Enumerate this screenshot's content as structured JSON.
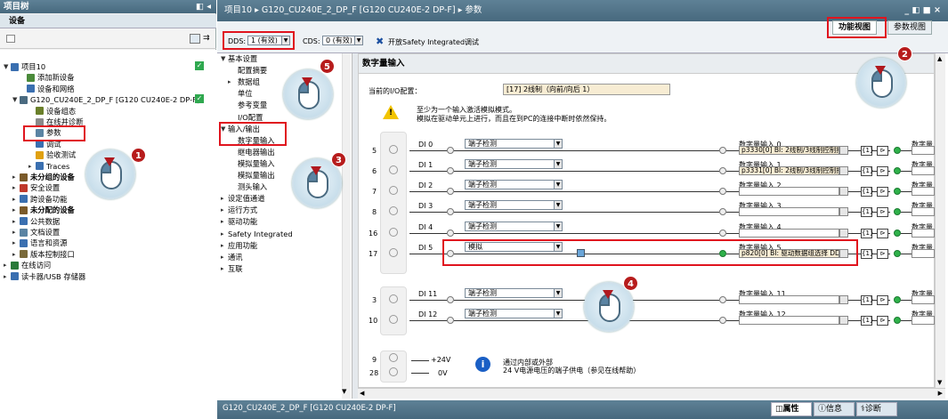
{
  "left": {
    "title": "项目树",
    "devices_tab": "设备",
    "tree": [
      {
        "label": "项目10",
        "bold": false,
        "check": true
      },
      {
        "label": "添加新设备"
      },
      {
        "label": "设备和网络"
      },
      {
        "label": "G120_CU240E_2_DP_F [G120 CU240E-2 DP-F]",
        "check": true
      },
      {
        "label": "设备组态"
      },
      {
        "label": "在线并诊断"
      },
      {
        "label": "参数"
      },
      {
        "label": "调试"
      },
      {
        "label": "验收测试"
      },
      {
        "label": "Traces"
      },
      {
        "label": "未分组的设备",
        "bold": true
      },
      {
        "label": "安全设置"
      },
      {
        "label": "跨设备功能"
      },
      {
        "label": "未分配的设备",
        "bold": true
      },
      {
        "label": "公共数据"
      },
      {
        "label": "文档设置"
      },
      {
        "label": "语言和资源"
      },
      {
        "label": "版本控制接口"
      },
      {
        "label": "在线访问"
      },
      {
        "label": "读卡器/USB 存储器"
      }
    ]
  },
  "breadcrumb": "项目10 ▸ G120_CU240E_2_DP_F [G120 CU240E-2 DP-F] ▸ 参数",
  "window_controls": "_ ◧ ■ ×",
  "toolbar": {
    "dds_label": "DDS:",
    "dds_value": "1 (有效)",
    "cds_label": "CDS:",
    "cds_value": "0 (有效)",
    "safety_btn": "开放Safety Integrated调试"
  },
  "tabs": {
    "function_view": "功能视图",
    "param_view": "参数视图"
  },
  "nav": [
    {
      "label": "基本设置",
      "level": 0,
      "open": true
    },
    {
      "label": "配置摘要",
      "level": 1
    },
    {
      "label": "数据组",
      "level": 1,
      "arrow": true
    },
    {
      "label": "单位",
      "level": 1
    },
    {
      "label": "参考变量",
      "level": 1
    },
    {
      "label": "I/O配置",
      "level": 1
    },
    {
      "label": "输入/输出",
      "level": 0,
      "open": true
    },
    {
      "label": "数字量输入",
      "level": 1
    },
    {
      "label": "继电器输出",
      "level": 1
    },
    {
      "label": "模拟量输入",
      "level": 1
    },
    {
      "label": "模拟量输出",
      "level": 1
    },
    {
      "label": "测头输入",
      "level": 1
    },
    {
      "label": "设定值通道",
      "level": 0
    },
    {
      "label": "运行方式",
      "level": 0
    },
    {
      "label": "驱动功能",
      "level": 0
    },
    {
      "label": "Safety Integrated",
      "level": 0
    },
    {
      "label": "应用功能",
      "level": 0
    },
    {
      "label": "通讯",
      "level": 0
    },
    {
      "label": "互联",
      "level": 0
    }
  ],
  "content": {
    "section_title": "数字量输入",
    "io_label": "当前的I/O配置：",
    "io_value": "[17] 2线制（向前/向后 1）",
    "warning_line1": "至少为一个输入激活模拟模式。",
    "warning_line2": "模拟在驱动单元上进行，而且在到PC的连接中断时依然保持。",
    "channels": [
      {
        "pin": "5",
        "name": "DI 0",
        "mode": "端子检测",
        "out_label": "数字量输入 0",
        "out_sig": "p3330[0] BI: 2线制/3线制控制指",
        "right": "数字量",
        "active": false
      },
      {
        "pin": "6",
        "name": "DI 1",
        "mode": "端子检测",
        "out_label": "数字量输入 1",
        "out_sig": "p3331[0] BI: 2线制/3线制控制指",
        "right": "数字量",
        "active": false
      },
      {
        "pin": "7",
        "name": "DI 2",
        "mode": "端子检测",
        "out_label": "数字量输入 2",
        "out_sig": "",
        "right": "数字量",
        "active": false
      },
      {
        "pin": "8",
        "name": "DI 3",
        "mode": "端子检测",
        "out_label": "数字量输入 3",
        "out_sig": "",
        "right": "数字量",
        "active": false
      },
      {
        "pin": "16",
        "name": "DI 4",
        "mode": "端子检测",
        "out_label": "数字量输入 4",
        "out_sig": "",
        "right": "数字量",
        "active": false
      },
      {
        "pin": "17",
        "name": "DI 5",
        "mode": "模拟",
        "out_label": "数字量输入 5",
        "out_sig": "p820[0] BI: 驱动数据组选择 DD:",
        "right": "数字量",
        "active": true
      },
      {
        "pin": "3",
        "name": "DI 11",
        "mode": "端子检测",
        "out_label": "数字量输入 11",
        "out_sig": "",
        "right": "数字量",
        "active": false
      },
      {
        "pin": "10",
        "name": "DI 12",
        "mode": "端子检测",
        "out_label": "数字量输入 12",
        "out_sig": "",
        "right": "数字量",
        "active": false
      }
    ],
    "pwr": {
      "pin1": "9",
      "v1": "+24V",
      "pin2": "28",
      "v2": "0V",
      "info1": "通过内部或外部",
      "info2": "24 V电源电压的端子供电（参见在线帮助）"
    }
  },
  "bottom": {
    "device": "G120_CU240E_2_DP_F [G120 CU240E-2 DP-F]",
    "props": "属性",
    "info": "信息",
    "diag": "诊断"
  },
  "steps": [
    "1",
    "2",
    "3",
    "4",
    "5"
  ]
}
